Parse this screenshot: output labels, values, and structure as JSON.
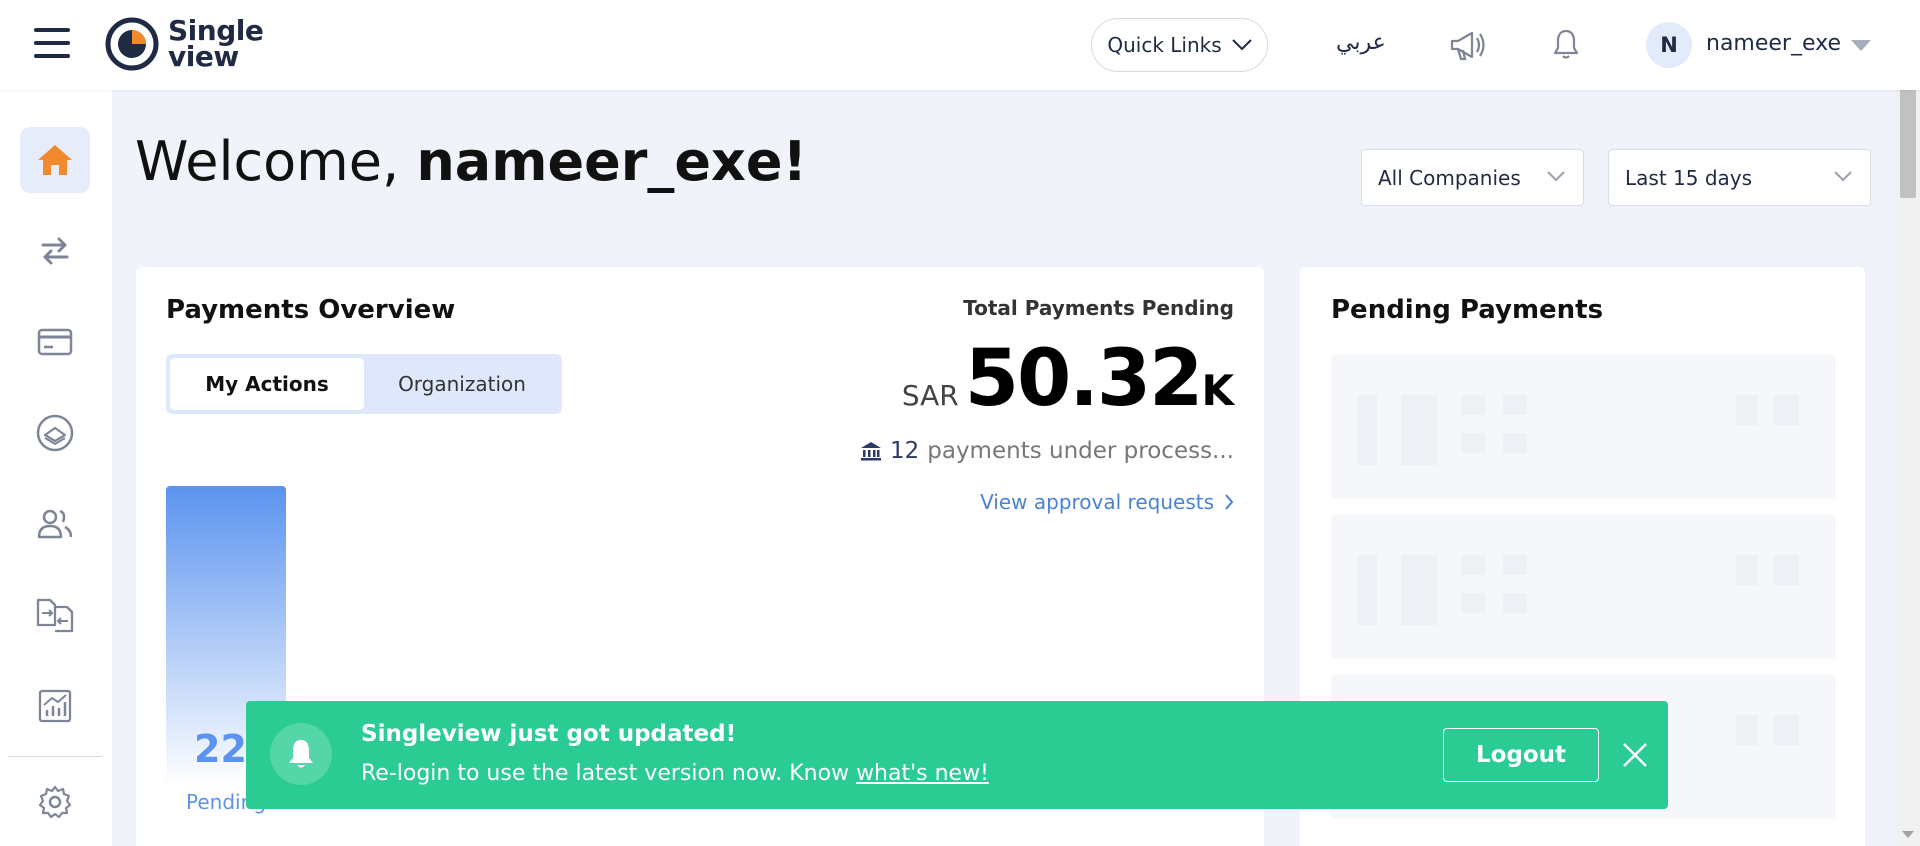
{
  "header": {
    "logo_line1": "Single",
    "logo_line2": "view",
    "quick_links": "Quick Links",
    "language": "عربي",
    "avatar_initial": "N",
    "username": "nameer_exe",
    "icons": [
      "menu-icon",
      "megaphone-icon",
      "bell-icon",
      "caret-down-icon"
    ]
  },
  "sidebar": {
    "items": [
      {
        "icon": "home-icon",
        "active": true
      },
      {
        "icon": "transfer-icon"
      },
      {
        "icon": "card-icon"
      },
      {
        "icon": "payments-icon"
      },
      {
        "icon": "users-icon"
      },
      {
        "icon": "documents-icon"
      },
      {
        "icon": "reports-icon"
      },
      {
        "icon": "settings-icon"
      }
    ],
    "colors": {
      "active_icon": "#f08a2c",
      "icon": "#7d8596"
    }
  },
  "main": {
    "welcome_prefix": "Welcome, ",
    "welcome_name": "nameer_exe!",
    "company_filter": "All Companies",
    "date_filter": "Last 15 days"
  },
  "payments_overview": {
    "title": "Payments Overview",
    "tabs": [
      "My Actions",
      "Organization"
    ],
    "total_label": "Total Payments Pending",
    "currency": "SAR",
    "amount": "50.32",
    "amount_suffix": "K",
    "process_count": "12",
    "process_text": "payments under process...",
    "view_link": "View approval requests",
    "bar_value": "220",
    "bar_label": "Pending"
  },
  "pending_payments": {
    "title": "Pending Payments"
  },
  "toast": {
    "title": "Singleview just got updated!",
    "message": "Re-login to use the latest version now. Know ",
    "link": "what's new!",
    "button": "Logout",
    "color": "#2acc93"
  }
}
